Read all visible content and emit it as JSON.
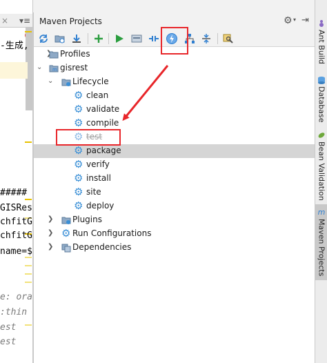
{
  "editor": {
    "tab_text": "×",
    "menu_text": "▾≡",
    "lines": [
      {
        "text": "-生成,",
        "style": "normal"
      },
      {
        "text": "#####",
        "style": "normal"
      },
      {
        "text": "GISRes",
        "style": "normal"
      },
      {
        "text": "chfitG",
        "style": "normal"
      },
      {
        "text": "chfitG",
        "style": "normal"
      },
      {
        "text": "name=$",
        "style": "normal"
      },
      {
        "text": "e: ora",
        "style": "italic"
      },
      {
        "text": ":thin",
        "style": "italic"
      },
      {
        "text": "est",
        "style": "italic"
      },
      {
        "text": "est",
        "style": "italic"
      }
    ],
    "error_badge": "!"
  },
  "maven": {
    "title": "Maven Projects",
    "settings_icon": "gear-icon",
    "hide_icon": "hide-panel-icon",
    "toolbar": [
      {
        "name": "reimport-button",
        "icon": "refresh-icon"
      },
      {
        "name": "generate-sources-button",
        "icon": "folder-refresh-icon"
      },
      {
        "name": "download-sources-button",
        "icon": "download-icon"
      },
      {
        "name": "add-project-button",
        "icon": "plus-icon"
      },
      {
        "name": "run-goal-button",
        "icon": "play-icon"
      },
      {
        "name": "execute-goal-button",
        "icon": "execute-icon"
      },
      {
        "name": "toggle-offline-button",
        "icon": "toggle-offline-icon"
      },
      {
        "name": "skip-tests-button",
        "icon": "lightning-icon"
      },
      {
        "name": "show-dependencies-button",
        "icon": "diagram-icon"
      },
      {
        "name": "collapse-all-button",
        "icon": "collapse-icon"
      },
      {
        "name": "maven-settings-button",
        "icon": "wrench-icon"
      }
    ],
    "tree": {
      "profiles": "Profiles",
      "project": "gisrest",
      "lifecycle": "Lifecycle",
      "goals": [
        "clean",
        "validate",
        "compile",
        "test",
        "package",
        "verify",
        "install",
        "site",
        "deploy"
      ],
      "skipped_goal": "test",
      "selected_goal": "package",
      "plugins": "Plugins",
      "run_configs": "Run Configurations",
      "dependencies": "Dependencies"
    }
  },
  "rightbar": {
    "tabs": [
      {
        "label": "Ant Build",
        "icon": "ant-icon",
        "active": false
      },
      {
        "label": "Database",
        "icon": "database-icon",
        "active": false
      },
      {
        "label": "Bean Validation",
        "icon": "bean-icon",
        "active": false
      },
      {
        "label": "Maven Projects",
        "icon": "maven-icon",
        "active": true
      }
    ]
  },
  "colors": {
    "accent_red": "#e8262a",
    "selection": "#d5d5d5",
    "gear_blue": "#3a8fd6"
  }
}
